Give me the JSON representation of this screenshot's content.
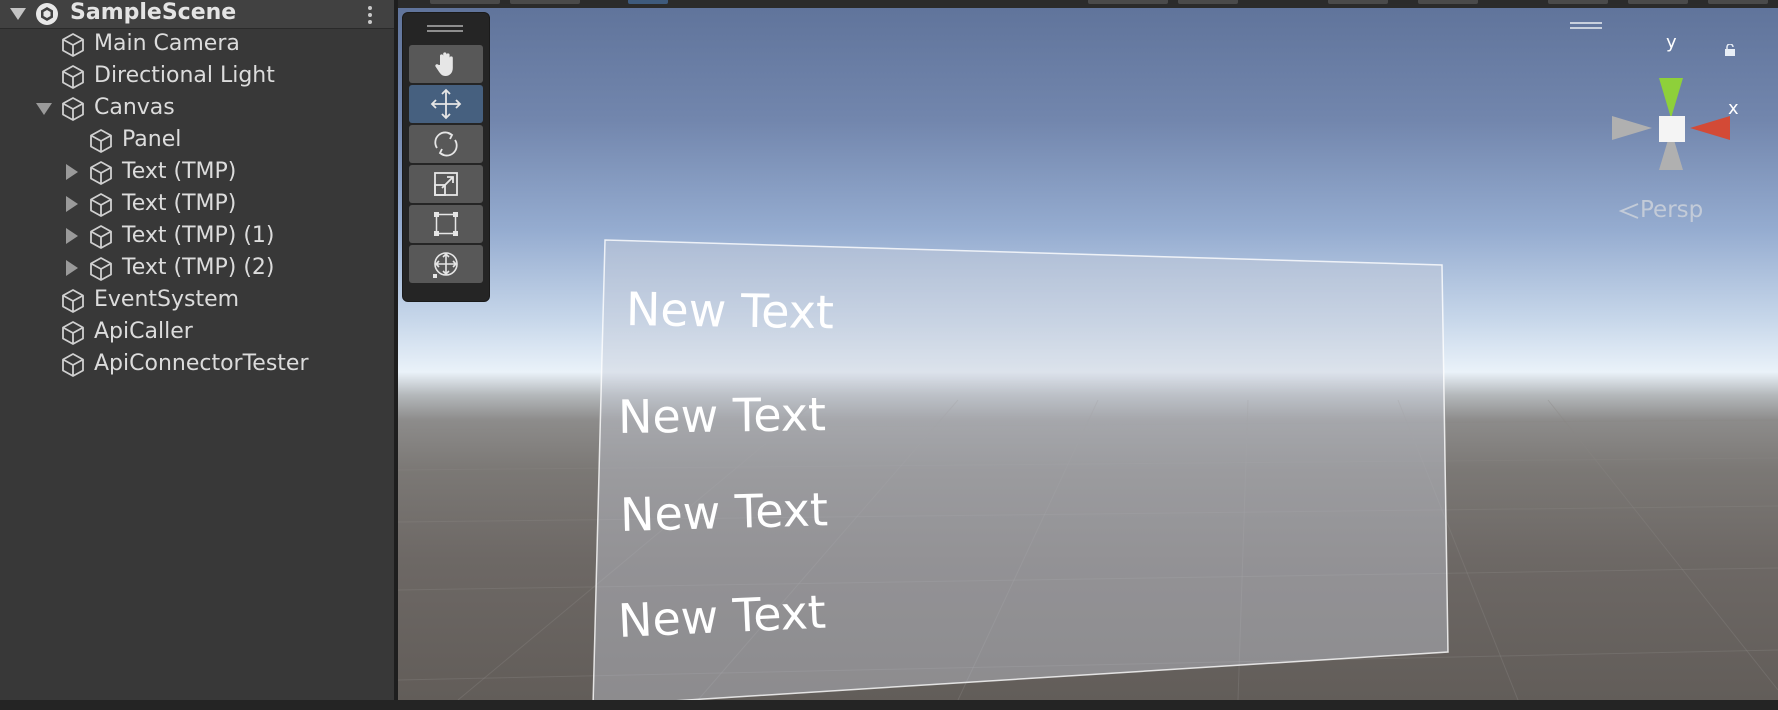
{
  "hierarchy": {
    "scene_name": "SampleScene",
    "items": [
      {
        "label": "Main Camera"
      },
      {
        "label": "Directional Light"
      },
      {
        "label": "Canvas"
      },
      {
        "label": "Panel"
      },
      {
        "label": "Text (TMP)"
      },
      {
        "label": "Text (TMP)"
      },
      {
        "label": "Text (TMP) (1)"
      },
      {
        "label": "Text (TMP) (2)"
      },
      {
        "label": "EventSystem"
      },
      {
        "label": "ApiCaller"
      },
      {
        "label": "ApiConnectorTester"
      }
    ]
  },
  "scene_view": {
    "camera_mode": "Persp",
    "gizmo_axes": {
      "y": "y",
      "x": "x"
    },
    "ui_texts": [
      "New Text",
      "New Text",
      "New Text",
      "New Text"
    ],
    "active_tool": "move",
    "tools": [
      "view-hand-tool",
      "move-tool",
      "rotate-tool",
      "scale-tool",
      "rect-tool",
      "transform-tool"
    ]
  },
  "colors": {
    "panel_bg": "#383838",
    "active_tool": "#46607f",
    "gizmo_y": "#8ed03a",
    "gizmo_x": "#d34a36"
  }
}
